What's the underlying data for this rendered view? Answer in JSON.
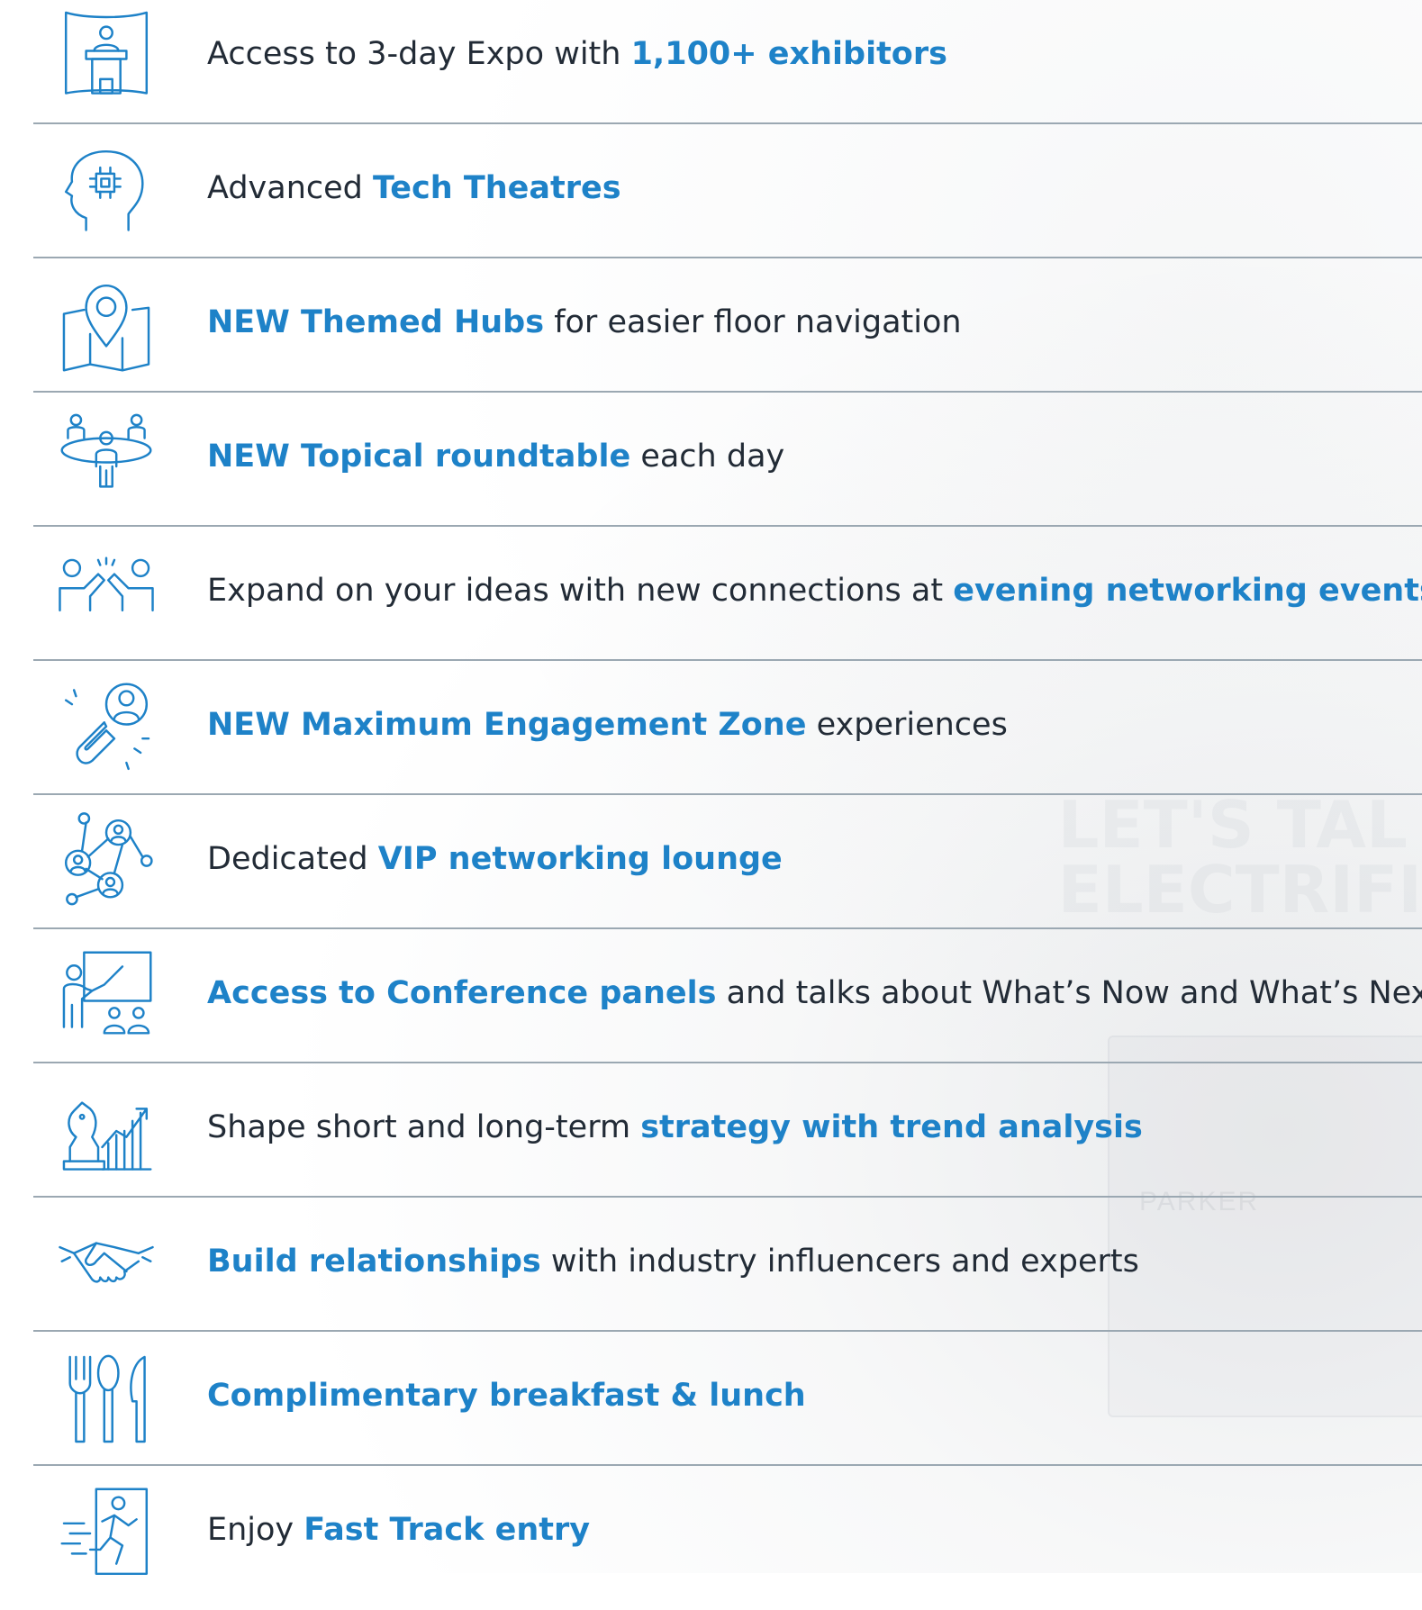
{
  "colors": {
    "accent": "#1e82c8",
    "text": "#222b36",
    "divider": "#9ba8b2"
  },
  "background_text": {
    "line1": "LET'S TAL",
    "line2": "ELECTRIFI",
    "brand": "PARKER"
  },
  "items": [
    {
      "icon": "podium-icon",
      "parts": [
        {
          "t": "Access to 3-day Expo with "
        },
        {
          "t": "1,100+ exhibitors",
          "h": 1
        }
      ]
    },
    {
      "icon": "brain-chip-icon",
      "parts": [
        {
          "t": "Advanced "
        },
        {
          "t": "Tech Theatres",
          "h": 1
        }
      ]
    },
    {
      "icon": "map-pin-icon",
      "parts": [
        {
          "t": "NEW Themed Hubs",
          "h": 1
        },
        {
          "t": " for easier floor navigation"
        }
      ]
    },
    {
      "icon": "roundtable-icon",
      "parts": [
        {
          "t": "NEW Topical roundtable",
          "h": 1
        },
        {
          "t": " each day"
        }
      ]
    },
    {
      "icon": "high-five-icon",
      "parts": [
        {
          "t": "Expand on your ideas with new connections at "
        },
        {
          "t": "evening networking events",
          "h": 1
        }
      ]
    },
    {
      "icon": "magnet-person-icon",
      "parts": [
        {
          "t": "NEW Maximum Engagement Zone",
          "h": 1
        },
        {
          "t": " experiences"
        }
      ]
    },
    {
      "icon": "network-people-icon",
      "parts": [
        {
          "t": "Dedicated "
        },
        {
          "t": "VIP networking lounge",
          "h": 1
        }
      ]
    },
    {
      "icon": "presentation-icon",
      "parts": [
        {
          "t": "Access to Conference panels",
          "h": 1
        },
        {
          "t": " and talks about What’s Now and What’s Next"
        }
      ]
    },
    {
      "icon": "chess-chart-icon",
      "parts": [
        {
          "t": "Shape short and long-term "
        },
        {
          "t": "strategy with trend analysis",
          "h": 1
        }
      ]
    },
    {
      "icon": "handshake-icon",
      "parts": [
        {
          "t": "Build relationships",
          "h": 1
        },
        {
          "t": " with industry influencers and experts"
        }
      ]
    },
    {
      "icon": "utensils-icon",
      "parts": [
        {
          "t": "Complimentary breakfast & lunch",
          "h": 1
        }
      ]
    },
    {
      "icon": "fast-track-icon",
      "parts": [
        {
          "t": "Enjoy "
        },
        {
          "t": "Fast Track entry",
          "h": 1
        }
      ]
    }
  ]
}
